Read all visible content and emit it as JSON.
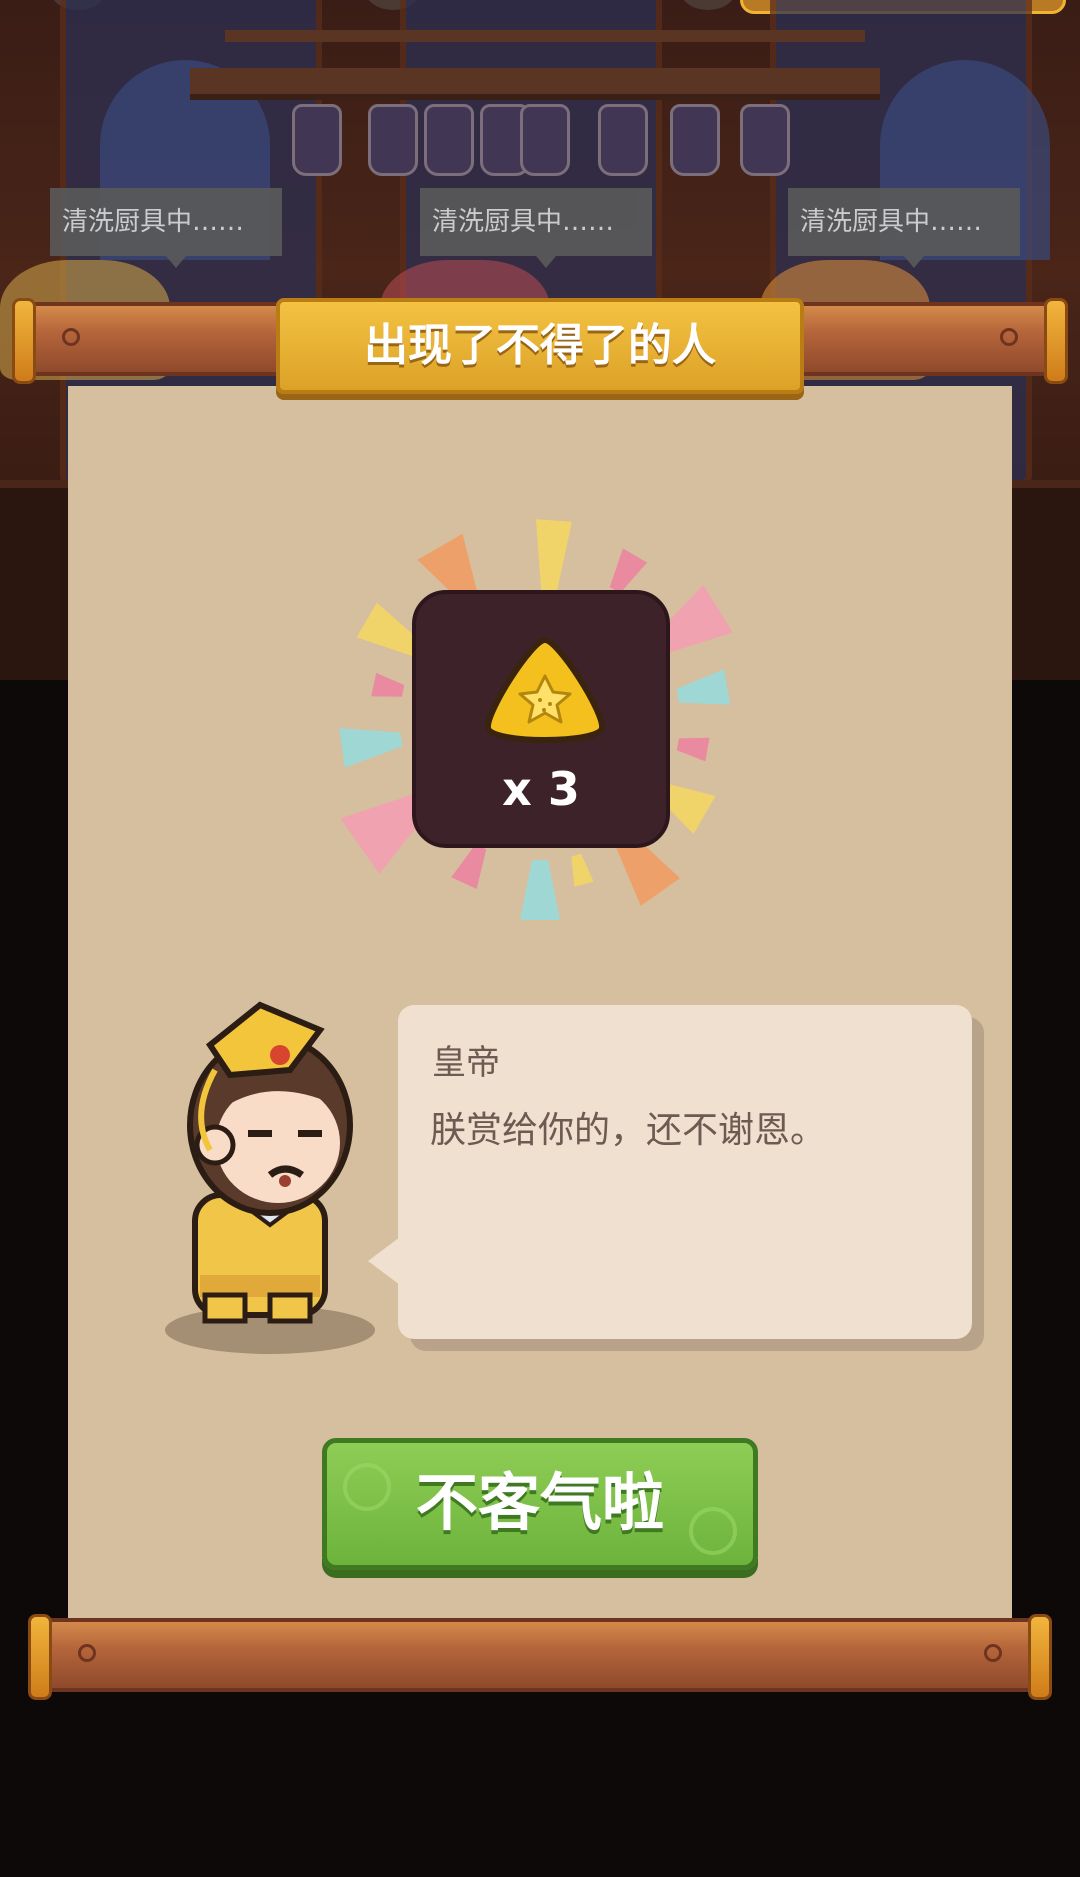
{
  "background": {
    "task_bubbles": [
      "清洗厨具中……",
      "清洗厨具中……",
      "清洗厨具中……"
    ]
  },
  "popup": {
    "title": "出现了不得了的人",
    "reward": {
      "icon": "gold-star-cookie-icon",
      "quantity": "x 3"
    },
    "speaker": "皇帝",
    "dialogue": "朕赏给你的，还不谢恩。",
    "confirm_button": "不客气啦"
  },
  "colors": {
    "title_banner": "#dba227",
    "confirm_button": "#6cb33c",
    "paper": "#d6bf9e",
    "reward_box": "#3e2229"
  }
}
